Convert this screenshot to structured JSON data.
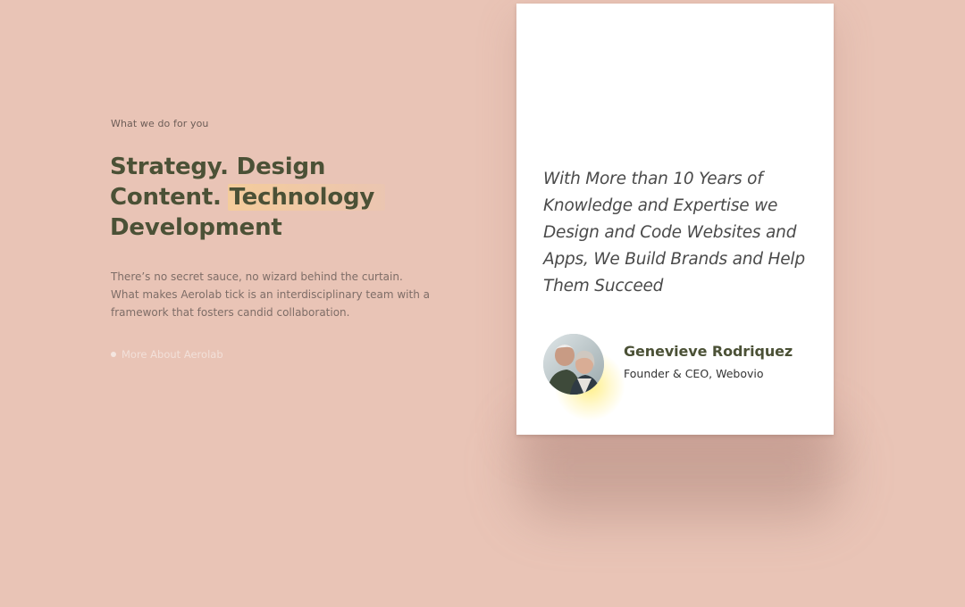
{
  "intro": {
    "eyebrow": "What we do for you",
    "headline_line1": "Strategy. Design",
    "headline_line2_a": "Content. ",
    "headline_line2_b": "Technology",
    "headline_line3": "Development",
    "description": "There’s no secret sauce, no wizard behind the curtain. What makes Aerolab tick is an interdisciplinary team with a framework that fosters candid collaboration.",
    "link_label": "More About Aerolab"
  },
  "testimonial": {
    "quote": "With More than 10 Years of Knowledge and Expertise we Design and Code Websites and Apps, We Build Brands and Help Them Succeed",
    "author_name": "Genevieve Rodriquez",
    "author_role": "Founder & CEO, Webovio",
    "avatar_icon": "avatar-photo"
  },
  "colors": {
    "background": "#e9c4b6",
    "headline": "#4b5136",
    "highlight": "#f6cd96",
    "card": "#ffffff"
  }
}
